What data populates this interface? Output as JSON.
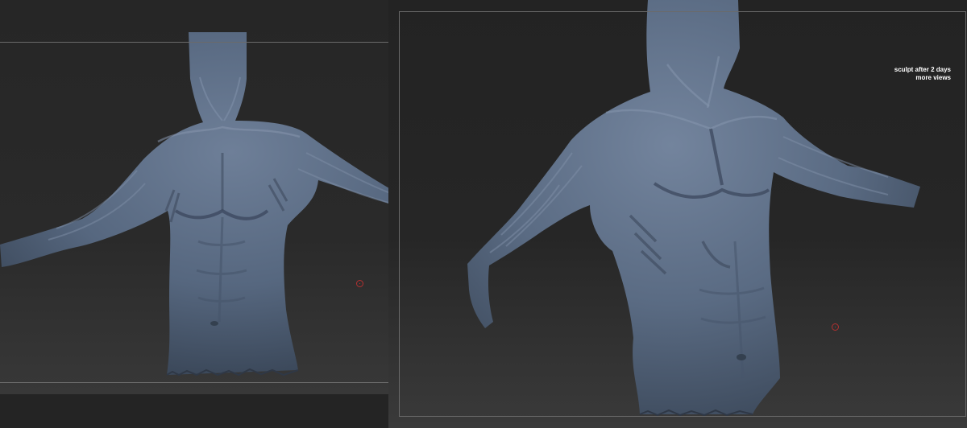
{
  "caption": {
    "line1": "sculpt after 2 days",
    "line2": "more views"
  },
  "colors": {
    "background": "#242424",
    "sculpt": "#5b6d86",
    "frame": "#6a6a6a",
    "cursor": "#b23030"
  },
  "icons": [
    "brush-cursor-icon",
    "brush-cursor-icon"
  ]
}
